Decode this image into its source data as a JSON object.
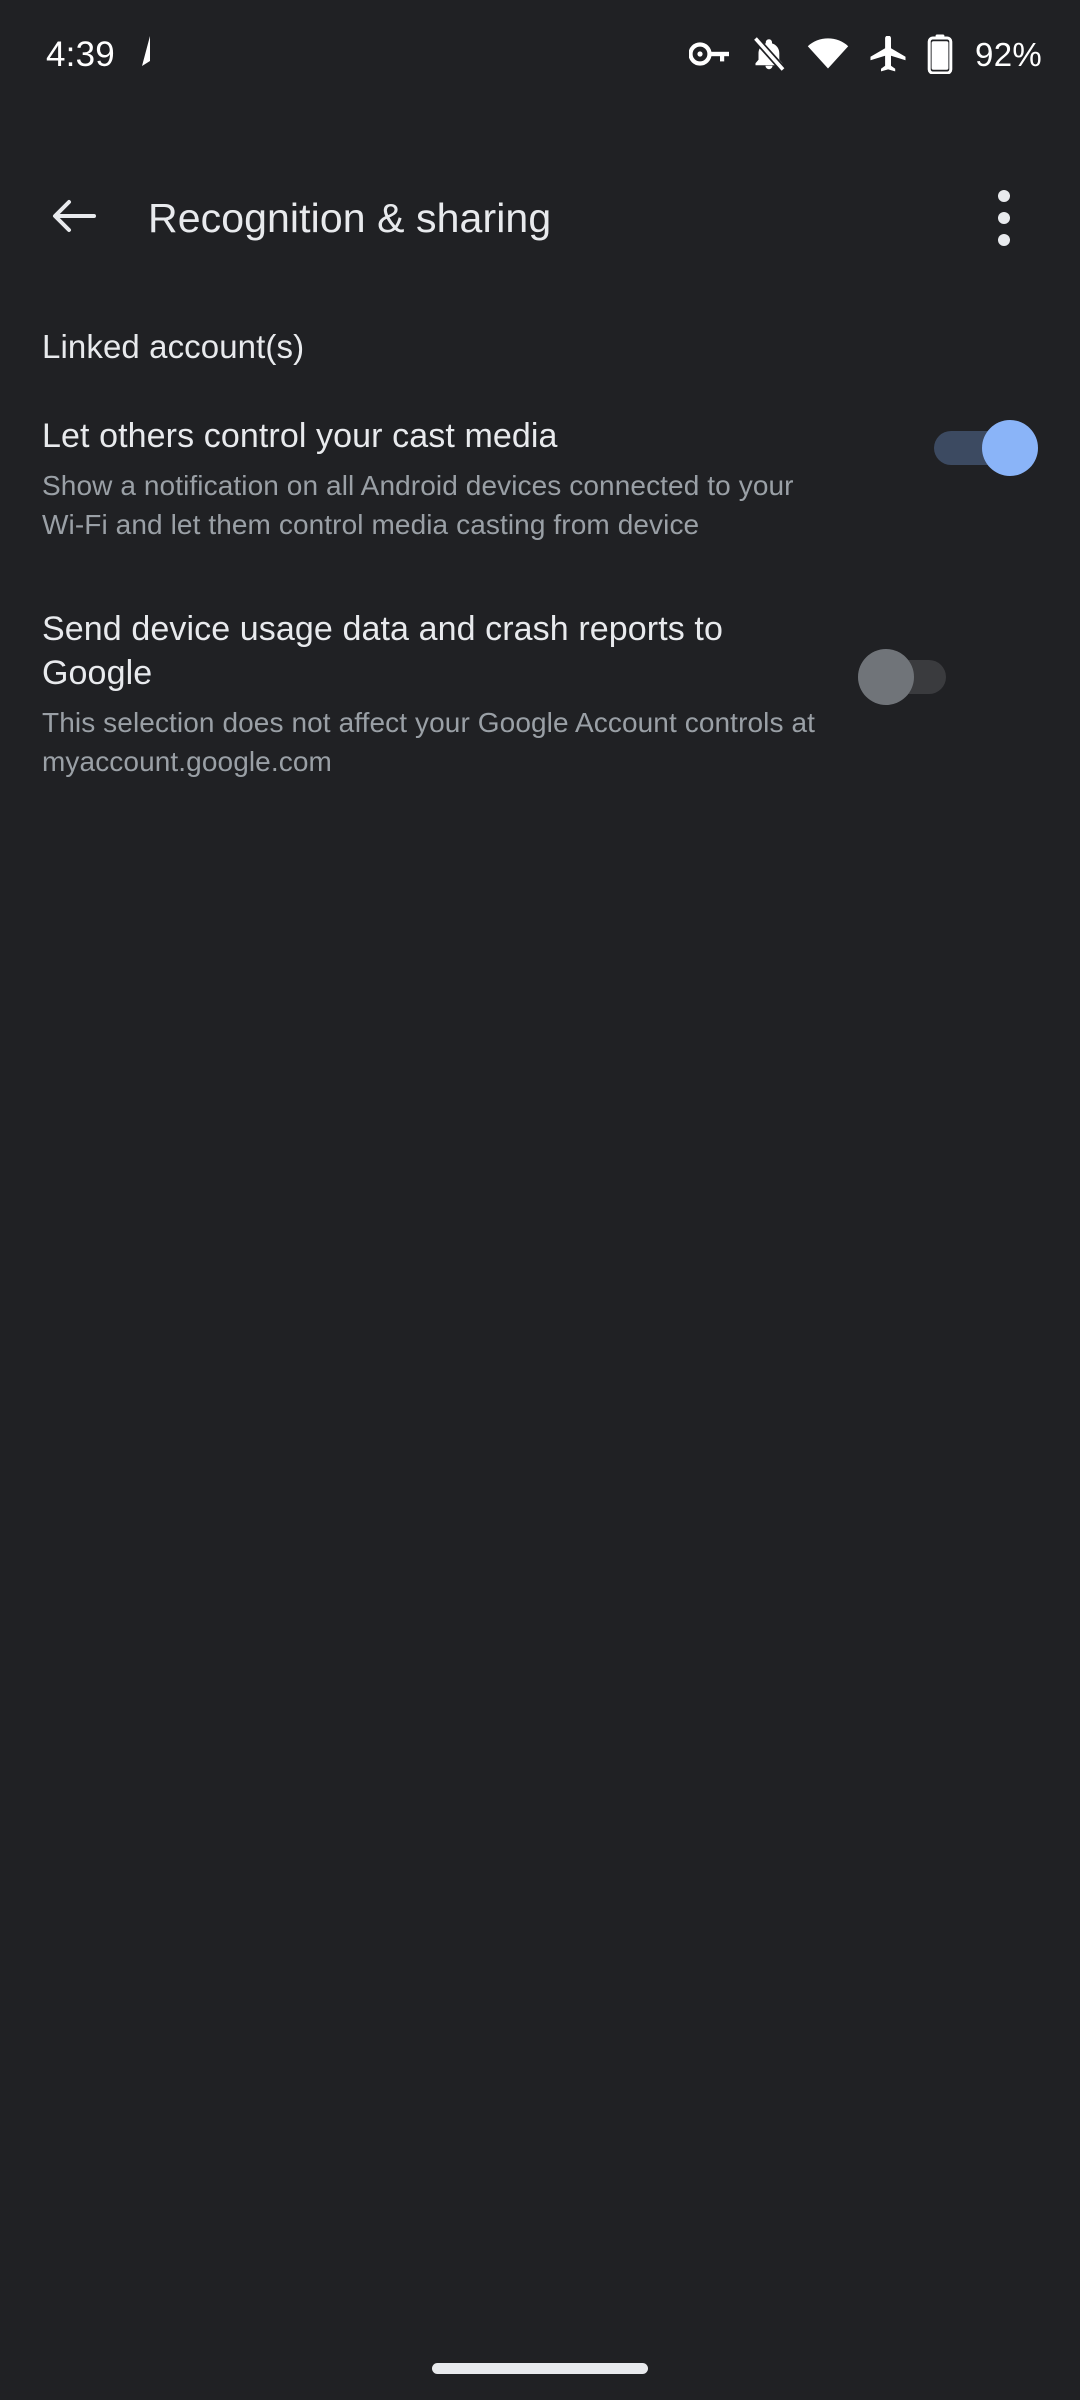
{
  "status_bar": {
    "time": "4:39",
    "location_icon": "navigation-arrow-icon",
    "icons": [
      {
        "name": "vpn-key-icon"
      },
      {
        "name": "notifications-off-icon"
      },
      {
        "name": "wifi-icon"
      },
      {
        "name": "airplane-mode-icon"
      },
      {
        "name": "battery-icon"
      }
    ],
    "battery_percent": "92%"
  },
  "app_bar": {
    "back_icon": "arrow-back-icon",
    "title": "Recognition & sharing",
    "overflow_icon": "more-vert-icon"
  },
  "content": {
    "section_header": "Linked account(s)",
    "preferences": [
      {
        "title": "Let others control your cast media",
        "summary": "Show a notification on all Android devices connected to your Wi-Fi and let them control media casting from device",
        "switch_state": "on"
      },
      {
        "title": "Send device usage data and crash reports to Google",
        "summary": "This selection does not affect your Google Account controls at myaccount.google.com",
        "switch_state": "off"
      }
    ]
  },
  "navigation": {
    "gesture_pill": "home-gesture-pill"
  },
  "colors": {
    "background": "#202124",
    "primary_text": "#e8eaed",
    "secondary_text": "#9aa0a6",
    "switch_on_thumb": "#8ab4f8",
    "switch_on_track": "#3c4a61",
    "switch_off_thumb": "#707479",
    "switch_off_track": "#3a3b3e"
  }
}
